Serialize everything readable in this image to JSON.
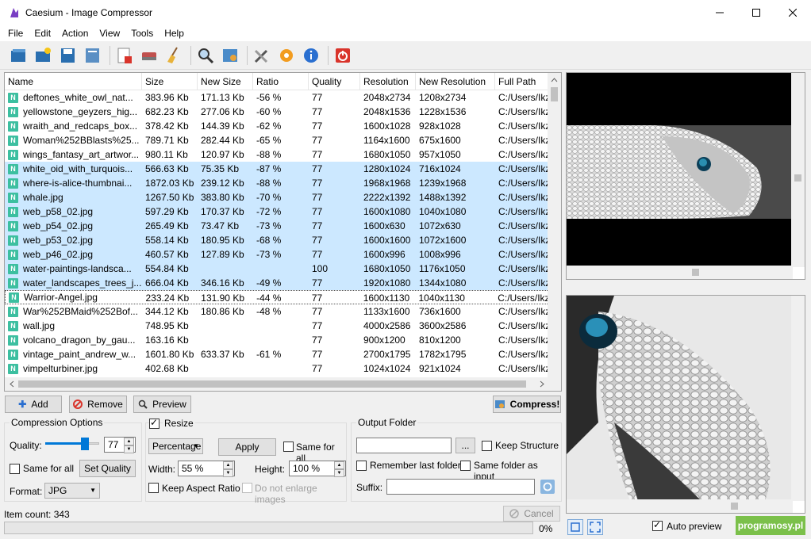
{
  "window": {
    "title": "Caesium - Image Compressor"
  },
  "menu": [
    "File",
    "Edit",
    "Action",
    "View",
    "Tools",
    "Help"
  ],
  "table": {
    "columns": [
      "Name",
      "Size",
      "New Size",
      "Ratio",
      "Quality",
      "Resolution",
      "New Resolution",
      "Full Path"
    ],
    "rows": [
      [
        "deftones_white_owl_nat...",
        "383.96 Kb",
        "171.13 Kb",
        "-56 %",
        "77",
        "2048x2734",
        "1208x2734",
        "C:/Users/Ikz/"
      ],
      [
        "yellowstone_geyzers_hig...",
        "682.23 Kb",
        "277.06 Kb",
        "-60 %",
        "77",
        "2048x1536",
        "1228x1536",
        "C:/Users/Ikz/"
      ],
      [
        "wraith_and_redcaps_box...",
        "378.42 Kb",
        "144.39 Kb",
        "-62 %",
        "77",
        "1600x1028",
        "928x1028",
        "C:/Users/Ikz/"
      ],
      [
        "Woman%252BBlasts%25...",
        "789.71 Kb",
        "282.44 Kb",
        "-65 %",
        "77",
        "1164x1600",
        "675x1600",
        "C:/Users/Ikz/"
      ],
      [
        "wings_fantasy_art_artwor...",
        "980.11 Kb",
        "120.97 Kb",
        "-88 %",
        "77",
        "1680x1050",
        "957x1050",
        "C:/Users/Ikz/"
      ],
      [
        "white_oid_with_turquois...",
        "566.63 Kb",
        "75.35 Kb",
        "-87 %",
        "77",
        "1280x1024",
        "716x1024",
        "C:/Users/Ikz/"
      ],
      [
        "where-is-alice-thumbnai...",
        "1872.03 Kb",
        "239.12 Kb",
        "-88 %",
        "77",
        "1968x1968",
        "1239x1968",
        "C:/Users/Ikz/"
      ],
      [
        "whale.jpg",
        "1267.50 Kb",
        "383.80 Kb",
        "-70 %",
        "77",
        "2222x1392",
        "1488x1392",
        "C:/Users/Ikz/"
      ],
      [
        "web_p58_02.jpg",
        "597.29 Kb",
        "170.37 Kb",
        "-72 %",
        "77",
        "1600x1080",
        "1040x1080",
        "C:/Users/Ikz/"
      ],
      [
        "web_p54_02.jpg",
        "265.49 Kb",
        "73.47 Kb",
        "-73 %",
        "77",
        "1600x630",
        "1072x630",
        "C:/Users/Ikz/"
      ],
      [
        "web_p53_02.jpg",
        "558.14 Kb",
        "180.95 Kb",
        "-68 %",
        "77",
        "1600x1600",
        "1072x1600",
        "C:/Users/Ikz/"
      ],
      [
        "web_p46_02.jpg",
        "460.57 Kb",
        "127.89 Kb",
        "-73 %",
        "77",
        "1600x996",
        "1008x996",
        "C:/Users/Ikz/"
      ],
      [
        "water-paintings-landsca...",
        "554.84 Kb",
        "",
        "",
        "100",
        "1680x1050",
        "1176x1050",
        "C:/Users/Ikz/"
      ],
      [
        "water_landscapes_trees_j...",
        "666.04 Kb",
        "346.16 Kb",
        "-49 %",
        "77",
        "1920x1080",
        "1344x1080",
        "C:/Users/Ikz/"
      ],
      [
        "Warrior-Angel.jpg",
        "233.24 Kb",
        "131.90 Kb",
        "-44 %",
        "77",
        "1600x1130",
        "1040x1130",
        "C:/Users/Ikz/"
      ],
      [
        "War%252BMaid%252Bof...",
        "344.12 Kb",
        "180.86 Kb",
        "-48 %",
        "77",
        "1133x1600",
        "736x1600",
        "C:/Users/Ikz/"
      ],
      [
        "wall.jpg",
        "748.95 Kb",
        "",
        "",
        "77",
        "4000x2586",
        "3600x2586",
        "C:/Users/Ikz/"
      ],
      [
        "volcano_dragon_by_gau...",
        "163.16 Kb",
        "",
        "",
        "77",
        "900x1200",
        "810x1200",
        "C:/Users/Ikz/"
      ],
      [
        "vintage_paint_andrew_w...",
        "1601.80 Kb",
        "633.37 Kb",
        "-61 %",
        "77",
        "2700x1795",
        "1782x1795",
        "C:/Users/Ikz/"
      ],
      [
        "vimpelturbiner.jpg",
        "402.68 Kb",
        "",
        "",
        "77",
        "1024x1024",
        "921x1024",
        "C:/Users/Ikz/"
      ]
    ],
    "selected_rows": [
      5,
      6,
      7,
      8,
      9,
      10,
      11,
      12,
      13
    ],
    "focus_row": 14,
    "icon_letter": "N"
  },
  "buttons": {
    "add": "Add",
    "remove": "Remove",
    "preview": "Preview",
    "compress": "Compress!",
    "cancel": "Cancel"
  },
  "compression": {
    "title": "Compression Options",
    "quality_label": "Quality:",
    "quality_value": "77",
    "quality_fraction": 0.77,
    "same_for_all": "Same for all",
    "set_quality": "Set Quality",
    "format_label": "Format:",
    "format_value": "JPG"
  },
  "resize": {
    "title": "Resize",
    "mode": "Percentage",
    "apply": "Apply",
    "same_for_all": "Same for all",
    "width_label": "Width:",
    "width_value": "55 %",
    "height_label": "Height:",
    "height_value": "100 %",
    "keep_aspect": "Keep Aspect Ratio",
    "no_enlarge": "Do not enlarge images"
  },
  "output": {
    "title": "Output Folder",
    "browse": "...",
    "keep_structure": "Keep Structure",
    "remember_last": "Remember last folder",
    "same_as_input": "Same folder as input",
    "suffix_label": "Suffix:"
  },
  "status": {
    "item_count": "Item count: 343",
    "progress_text": "0%",
    "progress": 0,
    "auto_preview": "Auto preview",
    "watermark": "programosy.pl"
  },
  "colors": {
    "selected": "#cce8ff",
    "accent": "#0078d7"
  }
}
